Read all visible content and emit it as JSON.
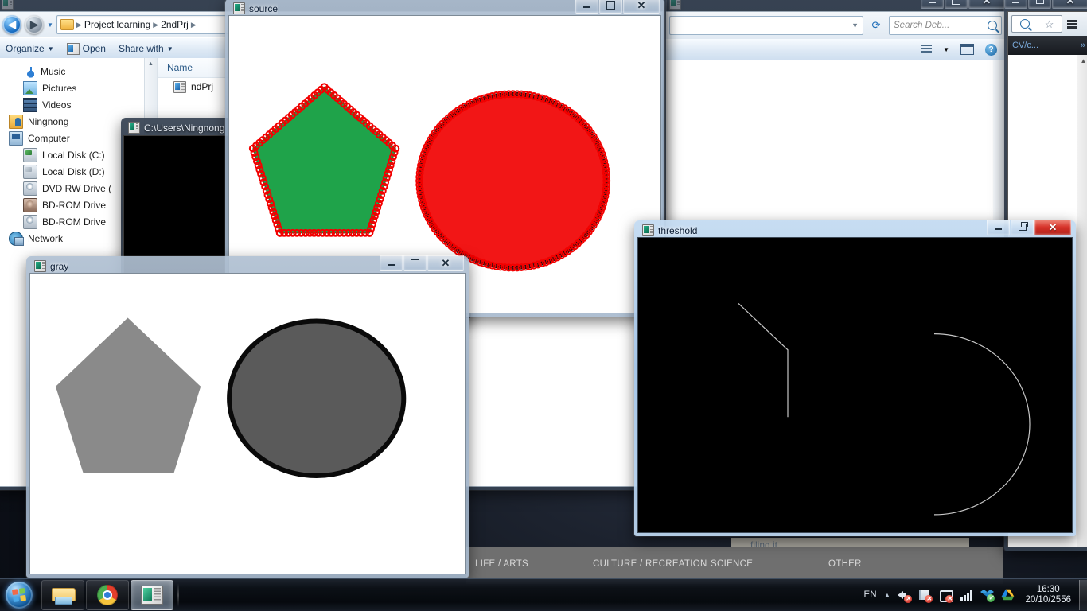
{
  "desktop": {
    "name": "windows-7-desktop"
  },
  "explorer1": {
    "title": "",
    "breadcrumbs": [
      "Project learning",
      "2ndPrj"
    ],
    "toolbar": {
      "organize": "Organize",
      "open": "Open",
      "share_with": "Share with"
    },
    "sidebar": {
      "items": [
        {
          "label": "Music",
          "icon": "music-icon",
          "indent": 1
        },
        {
          "label": "Pictures",
          "icon": "pictures-icon",
          "indent": 1
        },
        {
          "label": "Videos",
          "icon": "videos-icon",
          "indent": 1
        },
        {
          "label": "Ningnong",
          "icon": "user-icon",
          "indent": 0
        },
        {
          "label": "Computer",
          "icon": "computer-icon",
          "indent": 0
        },
        {
          "label": "Local Disk (C:)",
          "icon": "disk-icon",
          "indent": 1
        },
        {
          "label": "Local Disk (D:)",
          "icon": "disk-icon",
          "indent": 1
        },
        {
          "label": "DVD RW Drive (",
          "icon": "dvd-icon",
          "indent": 1
        },
        {
          "label": "BD-ROM Drive",
          "icon": "bd-icon",
          "indent": 1
        },
        {
          "label": "BD-ROM Drive",
          "icon": "dvd-icon",
          "indent": 1
        },
        {
          "label": "Network",
          "icon": "network-icon",
          "indent": 0
        }
      ]
    },
    "list": {
      "columns": [
        "Name"
      ],
      "rows": [
        {
          "name": "ndPrj"
        }
      ]
    },
    "window_buttons": {
      "minimize": "Minimize",
      "maximize": "Maximize",
      "close": "Close"
    }
  },
  "explorer2": {
    "title": "",
    "search_placeholder": "Search Deb...",
    "window_buttons": {
      "minimize": "Minimize",
      "maximize": "Maximize",
      "close": "Close"
    }
  },
  "browser": {
    "tab_label": "CV/c...",
    "overflow": "»",
    "window_buttons": {
      "minimize": "Minimize",
      "restore": "Restore",
      "close": "Close"
    }
  },
  "console_window": {
    "title": "C:\\Users\\Ningnong"
  },
  "source_window": {
    "title": "source",
    "icon": "opencv-window-icon",
    "window_buttons": {
      "minimize": "Minimize",
      "maximize": "Maximize",
      "close": "Close"
    },
    "content": {
      "type": "opencv-contour-overlay",
      "shapes": [
        {
          "name": "pentagon",
          "fill": "#1fa34a",
          "marker_color": "#f20000",
          "marker": "circle-outline"
        },
        {
          "name": "circle",
          "fill": "#f21616",
          "outline": "#000000",
          "marker_color": "#f20000",
          "marker": "circle-outline"
        }
      ]
    }
  },
  "gray_window": {
    "title": "gray",
    "icon": "opencv-window-icon",
    "window_buttons": {
      "minimize": "Minimize",
      "maximize": "Maximize",
      "close": "Close"
    },
    "content": {
      "type": "grayscale-image",
      "shapes": [
        {
          "name": "pentagon",
          "fill": "#8a8a8a"
        },
        {
          "name": "circle",
          "fill": "#5a5a5a",
          "outline": "#000000"
        }
      ]
    }
  },
  "threshold_window": {
    "title": "threshold",
    "icon": "opencv-window-icon",
    "active": true,
    "window_buttons": {
      "minimize": "Minimize",
      "restore": "Restore",
      "close": "Close"
    },
    "content": {
      "type": "binary-edge-image",
      "background": "#000000",
      "edge_color": "#cfcfcf",
      "shapes": [
        "pentagon-edge-partial",
        "circle-edge-partial"
      ]
    }
  },
  "webpage_footer": {
    "columns": [
      "LIFE / ARTS",
      "CULTURE / RECREATION",
      "SCIENCE",
      "OTHER"
    ],
    "tooltip_text": "filing it"
  },
  "taskbar": {
    "start": "Start",
    "buttons": [
      {
        "label": "Windows Explorer",
        "icon": "explorer-icon",
        "active": false
      },
      {
        "label": "Google Chrome",
        "icon": "chrome-icon",
        "active": false
      },
      {
        "label": "OpenCV Window",
        "icon": "cv-app-icon",
        "active": true
      }
    ],
    "tray": {
      "language": "EN",
      "show_hidden": "show-hidden-icons",
      "icons": [
        {
          "name": "volume-muted-icon"
        },
        {
          "name": "action-center-flag-error-icon"
        },
        {
          "name": "network-error-icon"
        },
        {
          "name": "signal-bars-icon"
        },
        {
          "name": "dropbox-icon"
        },
        {
          "name": "google-drive-icon"
        }
      ],
      "time": "16:30",
      "date": "20/10/2556"
    },
    "show_desktop": "Show desktop"
  }
}
